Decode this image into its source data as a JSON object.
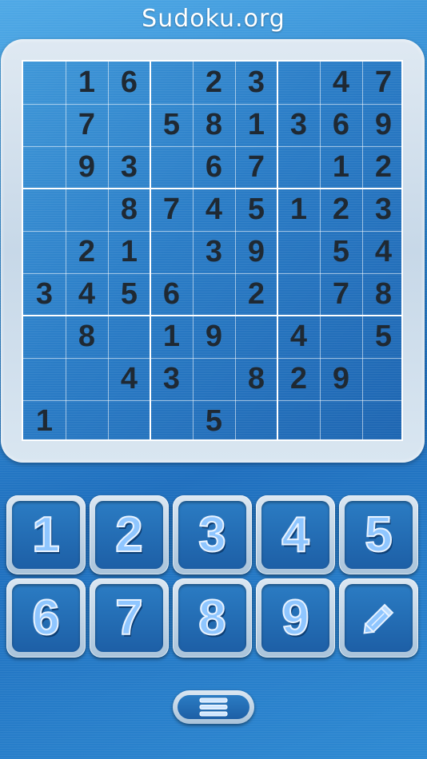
{
  "app": {
    "title": "Sudoku.org"
  },
  "board": {
    "rows": [
      [
        "",
        "1",
        "6",
        "",
        "2",
        "3",
        "",
        "4",
        "7"
      ],
      [
        "",
        "7",
        "",
        "5",
        "8",
        "1",
        "3",
        "6",
        "9"
      ],
      [
        "",
        "9",
        "3",
        "",
        "6",
        "7",
        "",
        "1",
        "2"
      ],
      [
        "",
        "",
        "8",
        "7",
        "4",
        "5",
        "1",
        "2",
        "3"
      ],
      [
        "",
        "2",
        "1",
        "",
        "3",
        "9",
        "",
        "5",
        "4"
      ],
      [
        "3",
        "4",
        "5",
        "6",
        "",
        "2",
        "",
        "7",
        "8"
      ],
      [
        "",
        "8",
        "",
        "1",
        "9",
        "",
        "4",
        "",
        "5"
      ],
      [
        "",
        "",
        "4",
        "3",
        "",
        "8",
        "2",
        "9",
        ""
      ],
      [
        "1",
        "",
        "",
        "",
        "5",
        "",
        "",
        "",
        ""
      ]
    ]
  },
  "keypad": {
    "keys": [
      "1",
      "2",
      "3",
      "4",
      "5",
      "6",
      "7",
      "8",
      "9"
    ],
    "pencil_icon": "pencil-icon"
  },
  "menu": {
    "icon": "menu-icon"
  }
}
